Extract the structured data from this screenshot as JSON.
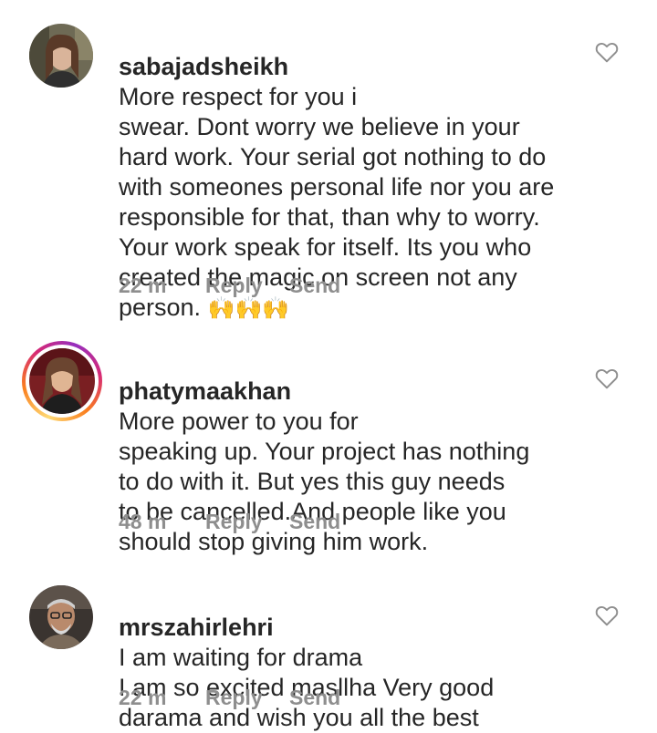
{
  "comments": [
    {
      "username": "sabajadsheikh",
      "text": "More respect for you i\nswear. Dont worry  we believe in your\nhard work. Your serial got nothing to do\nwith someones personal life nor you are\nresponsible for that, than why to worry.\nYour work speak for itself. Its you who\ncreated the magic on screen not any\nperson. ",
      "emoji": "🙌🙌🙌",
      "time": "22 m",
      "reply_label": "Reply",
      "send_label": "Send",
      "avatar_icon": "avatar-photo",
      "like_icon": "heart-outline-icon"
    },
    {
      "username": "phatymaakhan",
      "text": "More power to you for\nspeaking up. Your project has nothing\nto do with it. But yes this guy needs\nto be cancelled.And  people like  you\nshould stop giving him work.",
      "time": "48 m",
      "reply_label": "Reply",
      "send_label": "Send",
      "avatar_icon": "avatar-photo-story-ring",
      "like_icon": "heart-outline-icon"
    },
    {
      "username": "mrszahirlehri",
      "text": "I am waiting for drama\nI am so excited  masllha Very good\ndarama and  wish you all the best",
      "time": "22 m",
      "reply_label": "Reply",
      "send_label": "Send",
      "avatar_icon": "avatar-photo",
      "like_icon": "heart-outline-icon"
    }
  ],
  "colors": {
    "text": "#262626",
    "meta": "#8e8e8e",
    "story_ring": [
      "#feda75",
      "#fa7e1e",
      "#d62976",
      "#962fbf"
    ]
  }
}
